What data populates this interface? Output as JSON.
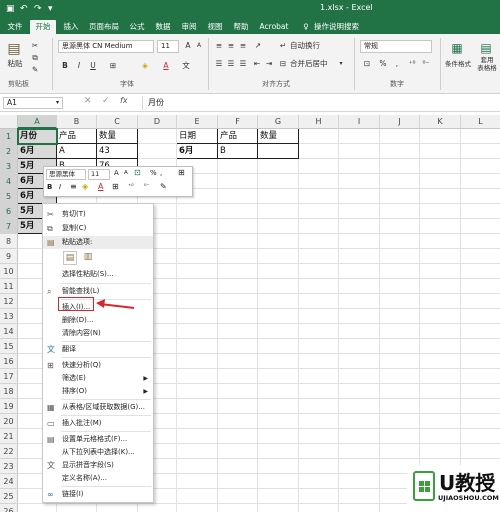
{
  "title_bar": {
    "file_name": "1.xlsx  -  Excel",
    "undo": "↶",
    "redo": "↷",
    "tell_me": "操作说明搜索"
  },
  "tabs": [
    "文件",
    "开始",
    "插入",
    "页面布局",
    "公式",
    "数据",
    "审阅",
    "视图",
    "帮助",
    "Acrobat"
  ],
  "ribbon": {
    "paste": "粘贴",
    "font_name": "思源黑体 CN Medium",
    "font_size": "11",
    "wrap_text": "自动换行",
    "merge_center": "合并后居中",
    "number_format": "常规",
    "conditional_format": "条件格式",
    "table_format_partial": "套用\n表格格",
    "groups": {
      "clipboard": "剪贴板",
      "font": "字体",
      "alignment": "对齐方式",
      "number": "数字"
    },
    "bold": "B",
    "italic": "I",
    "underline": "U",
    "percent": "%",
    "comma": ","
  },
  "formula_bar": {
    "name_box": "A1",
    "fx": "fx",
    "content": "月份"
  },
  "columns": [
    "A",
    "B",
    "C",
    "D",
    "E",
    "F",
    "G",
    "H",
    "I",
    "J",
    "K",
    "L"
  ],
  "rows": [
    "1",
    "2",
    "3",
    "4",
    "5",
    "6",
    "7",
    "8",
    "9",
    "10",
    "11",
    "12",
    "13",
    "14",
    "15",
    "16",
    "17",
    "18",
    "19",
    "20",
    "21",
    "22",
    "23",
    "24",
    "25",
    "26",
    "27"
  ],
  "cells": {
    "A1": "月份",
    "B1": "产品",
    "C1": "数量",
    "A2": "6月",
    "B2": "A",
    "C2": "43",
    "A3": "5月",
    "B3": "B",
    "C3": "76",
    "A4": "6月",
    "A5": "6月",
    "A6": "5月",
    "A7": "5月",
    "B7": "",
    "C7": "",
    "E1": "日期",
    "F1": "产品",
    "G1": "数量",
    "E2": "6月",
    "F2": "B",
    "G2": ""
  },
  "mini_toolbar": {
    "font_name": "思源黑体",
    "font_size": "11",
    "bold": "B",
    "italic": "I",
    "percent": "%"
  },
  "context_menu": {
    "items": [
      {
        "label": "剪切(T)",
        "icon": "scissors-icon"
      },
      {
        "label": "复制(C)",
        "icon": "copy-icon"
      },
      {
        "label": "粘贴选项:",
        "icon": "paste-icon"
      },
      {
        "label": "",
        "icon": "paste-option-icons"
      },
      {
        "label": "选择性粘贴(S)...",
        "icon": ""
      },
      {
        "label": "智能查找(L)",
        "icon": "search-icon"
      },
      {
        "label": "插入(I)...",
        "icon": ""
      },
      {
        "label": "删除(D)...",
        "icon": ""
      },
      {
        "label": "清除内容(N)",
        "icon": ""
      },
      {
        "label": "翻译",
        "icon": "translate-icon"
      },
      {
        "label": "快速分析(Q)",
        "icon": "quick-analysis-icon"
      },
      {
        "label": "筛选(E)",
        "icon": ""
      },
      {
        "label": "排序(O)",
        "icon": ""
      },
      {
        "label": "从表格/区域获取数据(G)...",
        "icon": "table-icon"
      },
      {
        "label": "插入批注(M)",
        "icon": "comment-icon"
      },
      {
        "label": "设置单元格格式(F)...",
        "icon": "format-cells-icon"
      },
      {
        "label": "从下拉列表中选择(K)...",
        "icon": ""
      },
      {
        "label": "显示拼音字段(S)",
        "icon": "phonetic-icon"
      },
      {
        "label": "定义名称(A)...",
        "icon": ""
      },
      {
        "label": "链接(I)",
        "icon": "link-icon"
      }
    ]
  },
  "watermark": {
    "brand": "U教授",
    "site": "UJIAOSHOU.COM"
  },
  "colors": {
    "excel_green": "#217346",
    "highlight_red": "#d9262b"
  }
}
